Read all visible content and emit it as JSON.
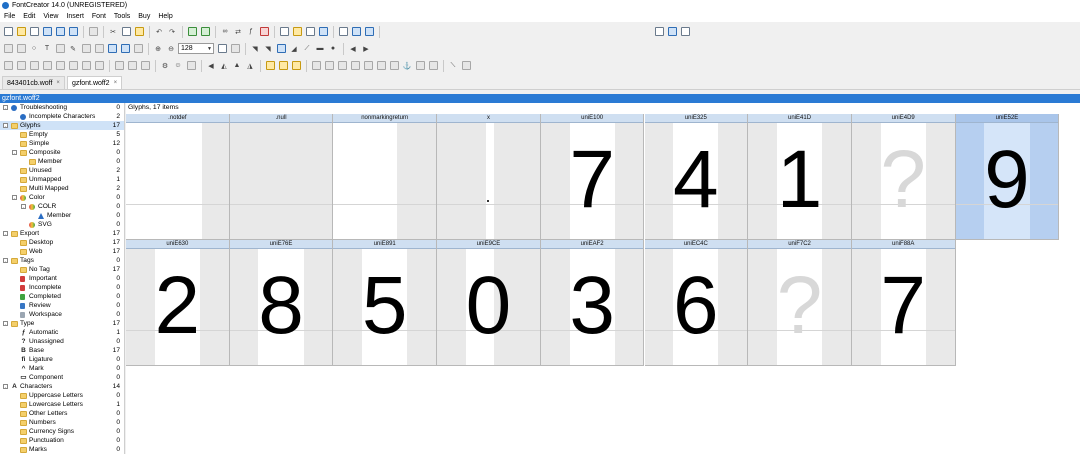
{
  "window": {
    "title": "FontCreator 14.0 (UNREGISTERED)"
  },
  "menu": [
    "File",
    "Edit",
    "View",
    "Insert",
    "Font",
    "Tools",
    "Buy",
    "Help"
  ],
  "toolbar": {
    "zoom_value": "128"
  },
  "tabs": [
    {
      "label": "843401cb.woff",
      "active": false
    },
    {
      "label": "gzfont.woff2",
      "active": true
    }
  ],
  "file_label": "gzfont.woff2",
  "overview": {
    "header": "Glyphs, 17 items"
  },
  "tree": [
    {
      "label": "Troubleshooting",
      "count": "0",
      "level": 0,
      "icon": "info",
      "expander": "-"
    },
    {
      "label": "Incomplete Characters",
      "count": "2",
      "level": 1,
      "icon": "info"
    },
    {
      "label": "Glyphs",
      "count": "17",
      "level": 0,
      "icon": "folder",
      "expander": "-",
      "selected": true
    },
    {
      "label": "Empty",
      "count": "5",
      "level": 1,
      "icon": "folder"
    },
    {
      "label": "Simple",
      "count": "12",
      "level": 1,
      "icon": "folder"
    },
    {
      "label": "Composite",
      "count": "0",
      "level": 1,
      "icon": "folder",
      "expander": "-"
    },
    {
      "label": "Member",
      "count": "0",
      "level": 2,
      "icon": "folder"
    },
    {
      "label": "Unused",
      "count": "2",
      "level": 1,
      "icon": "folder"
    },
    {
      "label": "Unmapped",
      "count": "1",
      "level": 1,
      "icon": "folder"
    },
    {
      "label": "Multi Mapped",
      "count": "2",
      "level": 1,
      "icon": "folder"
    },
    {
      "label": "Color",
      "count": "0",
      "level": 1,
      "icon": "color",
      "expander": "-"
    },
    {
      "label": "COLR",
      "count": "0",
      "level": 2,
      "icon": "color",
      "expander": "-"
    },
    {
      "label": "Member",
      "count": "0",
      "level": 3,
      "icon": "tri"
    },
    {
      "label": "SVG",
      "count": "0",
      "level": 2,
      "icon": "color"
    },
    {
      "label": "Export",
      "count": "17",
      "level": 0,
      "icon": "folder",
      "expander": "-"
    },
    {
      "label": "Desktop",
      "count": "17",
      "level": 1,
      "icon": "folder"
    },
    {
      "label": "Web",
      "count": "17",
      "level": 1,
      "icon": "folder"
    },
    {
      "label": "Tags",
      "count": "0",
      "level": 0,
      "icon": "folder",
      "expander": "-"
    },
    {
      "label": "No Tag",
      "count": "17",
      "level": 1,
      "icon": "folder"
    },
    {
      "label": "Important",
      "count": "0",
      "level": 1,
      "icon": "flag-red"
    },
    {
      "label": "Incomplete",
      "count": "0",
      "level": 1,
      "icon": "flag-red"
    },
    {
      "label": "Completed",
      "count": "0",
      "level": 1,
      "icon": "flag-green"
    },
    {
      "label": "Review",
      "count": "0",
      "level": 1,
      "icon": "flag-blue"
    },
    {
      "label": "Workspace",
      "count": "0",
      "level": 1,
      "icon": "flag-grey"
    },
    {
      "label": "Type",
      "count": "17",
      "level": 0,
      "icon": "folder",
      "expander": "-"
    },
    {
      "label": "Automatic",
      "count": "1",
      "level": 1,
      "icon": "glyph-txt",
      "glyph": "ƒ"
    },
    {
      "label": "Unassigned",
      "count": "0",
      "level": 1,
      "icon": "glyph-txt",
      "glyph": "?"
    },
    {
      "label": "Base",
      "count": "17",
      "level": 1,
      "icon": "glyph-txt",
      "glyph": "B"
    },
    {
      "label": "Ligature",
      "count": "0",
      "level": 1,
      "icon": "glyph-txt",
      "glyph": "fi"
    },
    {
      "label": "Mark",
      "count": "0",
      "level": 1,
      "icon": "glyph-txt",
      "glyph": "^"
    },
    {
      "label": "Component",
      "count": "0",
      "level": 1,
      "icon": "glyph-txt",
      "glyph": "▭"
    },
    {
      "label": "Characters",
      "count": "14",
      "level": 0,
      "icon": "glyph-txt",
      "glyph": "A",
      "expander": "-"
    },
    {
      "label": "Uppercase Letters",
      "count": "0",
      "level": 1,
      "icon": "folder"
    },
    {
      "label": "Lowercase Letters",
      "count": "1",
      "level": 1,
      "icon": "folder"
    },
    {
      "label": "Other Letters",
      "count": "0",
      "level": 1,
      "icon": "folder"
    },
    {
      "label": "Numbers",
      "count": "0",
      "level": 1,
      "icon": "folder"
    },
    {
      "label": "Currency Signs",
      "count": "0",
      "level": 1,
      "icon": "folder"
    },
    {
      "label": "Punctuation",
      "count": "0",
      "level": 1,
      "icon": "folder"
    },
    {
      "label": "Marks",
      "count": "0",
      "level": 1,
      "icon": "folder"
    }
  ],
  "glyphs": [
    {
      "name": ".notdef",
      "char": "",
      "adv": [
        0,
        0.74
      ]
    },
    {
      "name": ".null",
      "char": "",
      "adv": [
        0,
        0
      ]
    },
    {
      "name": "nonmarkingreturn",
      "char": "",
      "adv": [
        0,
        0.62
      ]
    },
    {
      "name": "x",
      "char": "",
      "adv": [
        0.48,
        0.55
      ],
      "dot": true
    },
    {
      "name": "uniE100",
      "char": "7",
      "adv": [
        0.28,
        0.72
      ]
    },
    {
      "name": "uniE325",
      "char": "4",
      "adv": [
        0.28,
        0.72
      ]
    },
    {
      "name": "uniE41D",
      "char": "1",
      "adv": [
        0.28,
        0.72
      ]
    },
    {
      "name": "uniE4D9",
      "char": "?",
      "adv": [
        0.28,
        0.72
      ],
      "missing": true
    },
    {
      "name": "uniE52E",
      "char": "9",
      "adv": [
        0.28,
        0.72
      ],
      "selected": true
    },
    {
      "name": "uniE630",
      "char": "2",
      "adv": [
        0.28,
        0.72
      ]
    },
    {
      "name": "uniE76E",
      "char": "8",
      "adv": [
        0.28,
        0.72
      ]
    },
    {
      "name": "uniE891",
      "char": "5",
      "adv": [
        0.28,
        0.72
      ]
    },
    {
      "name": "uniE9CE",
      "char": "0",
      "adv": [
        0.28,
        0.55
      ]
    },
    {
      "name": "uniEAF2",
      "char": "3",
      "adv": [
        0.28,
        0.72
      ]
    },
    {
      "name": "uniEC4C",
      "char": "6",
      "adv": [
        0.28,
        0.72
      ]
    },
    {
      "name": "uniF7C2",
      "char": "?",
      "adv": [
        0.28,
        0.72
      ],
      "missing": true
    },
    {
      "name": "uniF88A",
      "char": "7",
      "adv": [
        0.28,
        0.72
      ]
    }
  ]
}
